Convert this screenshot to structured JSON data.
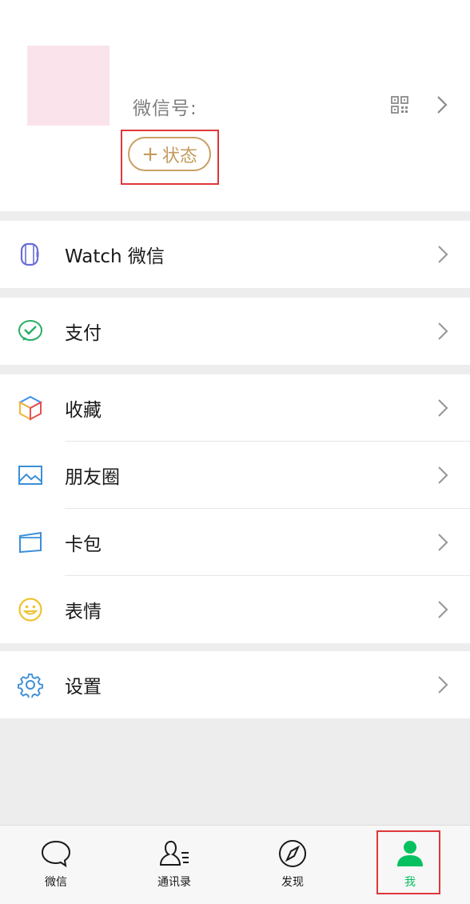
{
  "profile": {
    "wechat_id_label": "微信号:",
    "status_plus": "+",
    "status_label": "状态"
  },
  "menu": {
    "watch": "Watch 微信",
    "pay": "支付",
    "favorites": "收藏",
    "moments": "朋友圈",
    "cards": "卡包",
    "stickers": "表情",
    "settings": "设置"
  },
  "tabbar": {
    "chats": "微信",
    "contacts": "通讯录",
    "discover": "发现",
    "me": "我",
    "active": "me"
  },
  "colors": {
    "accent_green": "#07c160",
    "status_gold": "#c49a5c",
    "highlight_red": "#e0373a"
  },
  "icons": [
    "qr-code-icon",
    "chevron-right-icon",
    "watch-icon",
    "pay-icon",
    "favorites-icon",
    "moments-icon",
    "card-wallet-icon",
    "sticker-icon",
    "settings-icon",
    "chat-bubble-icon",
    "contacts-icon",
    "compass-icon",
    "person-icon"
  ]
}
